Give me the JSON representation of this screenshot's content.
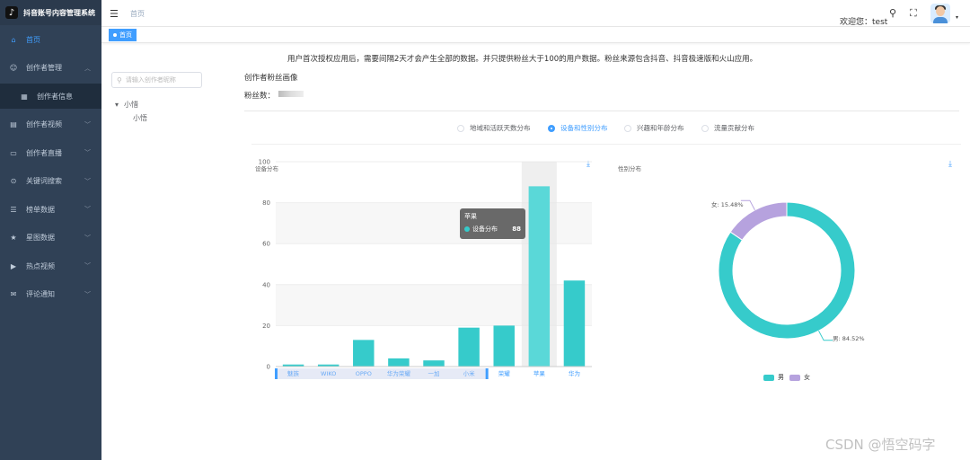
{
  "app": {
    "title": "抖音账号内容管理系统",
    "logo_glyph": "♪"
  },
  "sidebar": {
    "items": [
      {
        "label": "首页",
        "icon": "home-icon",
        "glyph": "⌂",
        "active": true
      },
      {
        "label": "创作者管理",
        "icon": "creator-icon",
        "glyph": "☺",
        "arrow": "︿"
      },
      {
        "label": "创作者信息",
        "icon": "grid-icon",
        "glyph": "▦",
        "sub": true
      },
      {
        "label": "创作者视频",
        "icon": "video-icon",
        "glyph": "▤",
        "arrow": "﹀"
      },
      {
        "label": "创作者直播",
        "icon": "monitor-icon",
        "glyph": "▭",
        "arrow": "﹀"
      },
      {
        "label": "关键词搜索",
        "icon": "search-icon",
        "glyph": "⊙",
        "arrow": "﹀"
      },
      {
        "label": "榜单数据",
        "icon": "list-icon",
        "glyph": "☰",
        "arrow": "﹀"
      },
      {
        "label": "星图数据",
        "icon": "star-icon",
        "glyph": "★",
        "arrow": "﹀"
      },
      {
        "label": "热点视频",
        "icon": "play-icon",
        "glyph": "▶",
        "arrow": "﹀"
      },
      {
        "label": "评论通知",
        "icon": "comment-icon",
        "glyph": "✉",
        "arrow": "﹀"
      }
    ]
  },
  "header": {
    "breadcrumb": "首页",
    "welcome": "欢迎您：test",
    "search_glyph": "⚲",
    "fullscreen_glyph": "⛶",
    "caret_glyph": "▾"
  },
  "tags": {
    "active": "首页"
  },
  "tree": {
    "search_placeholder": "请输入创作者昵称",
    "parent": "小惜",
    "child": "小悟"
  },
  "main": {
    "notice": "用户首次授权应用后，需要间隔2天才会产生全部的数据。并只提供粉丝大于100的用户数据。粉丝来源包含抖音、抖音极速版和火山应用。",
    "section_title": "创作者粉丝画像",
    "fans_label": "粉丝数：",
    "radios": [
      {
        "label": "地域和活跃天数分布",
        "checked": false
      },
      {
        "label": "设备和性别分布",
        "checked": true
      },
      {
        "label": "兴趣和年龄分布",
        "checked": false
      },
      {
        "label": "流量贡献分布",
        "checked": false
      }
    ],
    "download_glyph": "⤓"
  },
  "chart_data": [
    {
      "type": "bar",
      "title": "设备分布",
      "categories": [
        "魅族",
        "WIKO",
        "OPPO",
        "华为荣耀",
        "一加",
        "小米",
        "荣耀",
        "苹果",
        "华为"
      ],
      "series": [
        {
          "name": "设备分布",
          "values": [
            1,
            1,
            13,
            4,
            3,
            19,
            20,
            88,
            42
          ]
        }
      ],
      "ylim": [
        0,
        100
      ],
      "yticks": [
        0,
        20,
        40,
        60,
        80,
        100
      ],
      "color": "#36cbcb",
      "grid": true,
      "tooltip": {
        "category": "苹果",
        "series": "设备分布",
        "value": 88
      }
    },
    {
      "type": "pie",
      "title": "性别分布",
      "donut": true,
      "slices": [
        {
          "name": "男",
          "value": 84.52,
          "label": "男: 84.52%",
          "color": "#36cbcb"
        },
        {
          "name": "女",
          "value": 15.48,
          "label": "女: 15.48%",
          "color": "#b6a2de"
        }
      ],
      "legend": [
        "男",
        "女"
      ],
      "legend_position": "bottom"
    }
  ],
  "watermark": "CSDN @悟空码字"
}
